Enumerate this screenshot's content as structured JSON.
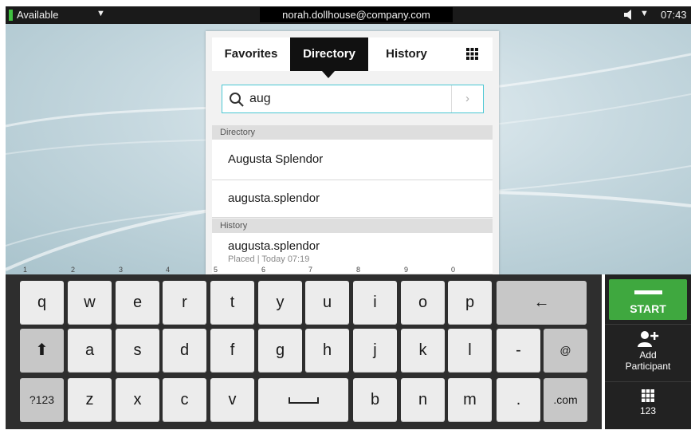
{
  "status_bar": {
    "presence": "Available",
    "account": "norah.dollhouse@company.com",
    "time": "07:43",
    "icons": [
      "presence-indicator",
      "caret-down",
      "speaker-icon",
      "caret-down"
    ]
  },
  "tabs": [
    {
      "label": "Favorites"
    },
    {
      "label": "Directory",
      "active": true
    },
    {
      "label": "History"
    },
    {
      "label": "",
      "icon": "dialpad-grid-icon"
    }
  ],
  "search": {
    "value": "aug",
    "icon": "search-icon",
    "go_icon": "chevron-right-icon"
  },
  "sections": [
    {
      "title": "Directory"
    },
    {
      "title": "History"
    }
  ],
  "results": [
    {
      "name": "Augusta Splendor"
    },
    {
      "name": "augusta.splendor"
    },
    {
      "name": "augusta.splendor",
      "detail": "Placed | Today 07:19"
    }
  ],
  "keyboard": {
    "row1": [
      {
        "label": "q",
        "num": "1"
      },
      {
        "label": "w",
        "num": "2"
      },
      {
        "label": "e",
        "num": "3"
      },
      {
        "label": "r",
        "num": "4"
      },
      {
        "label": "t",
        "num": "5"
      },
      {
        "label": "y",
        "num": "6"
      },
      {
        "label": "u",
        "num": "7"
      },
      {
        "label": "i",
        "num": "8"
      },
      {
        "label": "o",
        "num": "9"
      },
      {
        "label": "p",
        "num": "0"
      },
      {
        "label": "←"
      }
    ],
    "row2": [
      {
        "label": "⬆"
      },
      {
        "label": "a"
      },
      {
        "label": "s"
      },
      {
        "label": "d"
      },
      {
        "label": "f"
      },
      {
        "label": "g"
      },
      {
        "label": "h"
      },
      {
        "label": "j"
      },
      {
        "label": "k"
      },
      {
        "label": "l"
      },
      {
        "label": "-"
      },
      {
        "label": "@"
      }
    ],
    "row3": [
      {
        "label": "?123"
      },
      {
        "label": "z"
      },
      {
        "label": "x"
      },
      {
        "label": "c"
      },
      {
        "label": "v"
      },
      {
        "label": "␣"
      },
      {
        "label": "b"
      },
      {
        "label": "n"
      },
      {
        "label": "m"
      },
      {
        "label": "."
      },
      {
        "label": ".com"
      }
    ]
  },
  "side_panel": {
    "start_label": "START",
    "add_participant_label": "Add Participant",
    "keypad_label": "123",
    "start_color": "#3fa83f"
  }
}
